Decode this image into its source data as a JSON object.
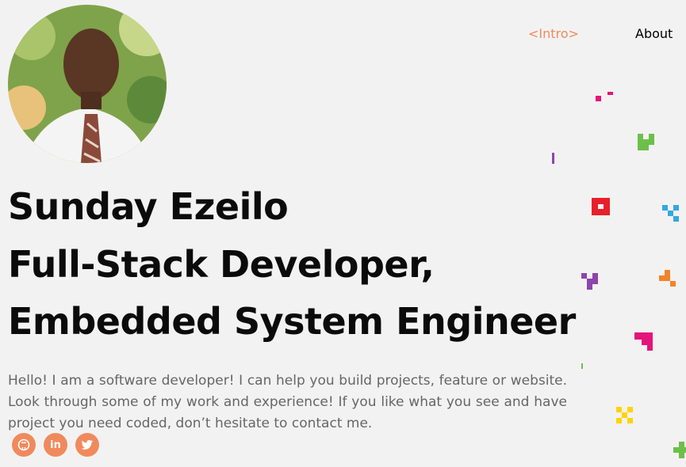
{
  "header": {
    "nav": [
      {
        "label": "<Intro>"
      },
      {
        "label": "About"
      }
    ]
  },
  "profile": {
    "headline_lines": [
      "Sunday Ezeilo",
      "Full-Stack Developer,",
      "Embedded System Engineer"
    ],
    "bio": "Hello! I am a software developer! I can help you build projects, feature or website. Look through some of my work and experience! If you like what you see and have project you need coded, don’t hesitate to contact me."
  },
  "socials": [
    {
      "icon": "github-icon"
    },
    {
      "icon": "linkedin-icon",
      "glyph": "in"
    },
    {
      "icon": "twitter-icon"
    }
  ],
  "colors": {
    "accent": "#f08a5d",
    "background": "#f3f2f2",
    "decor": [
      "#e4147a",
      "#6cc04a",
      "#8e44ad",
      "#e8202a",
      "#33a8e0",
      "#f2832a",
      "#ffd400"
    ]
  }
}
